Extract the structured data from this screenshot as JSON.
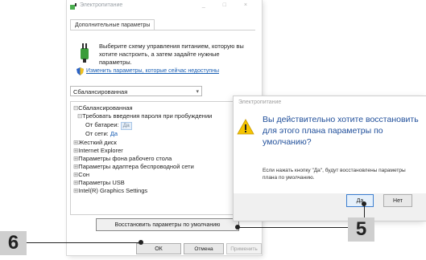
{
  "window": {
    "title": "Электропитание",
    "controls": "_ □ ×",
    "tab_label": "Дополнительные параметры",
    "intro_text": "Выберите схему управления питанием, которую вы хотите настроить, а затем задайте нужные параметры.",
    "change_link": "Изменить параметры, которые сейчас недоступны",
    "scheme_selected": "Сбалансированная"
  },
  "tree": {
    "root": "Сбалансированная",
    "require_password": "Требовать введения пароля при пробуждении",
    "on_battery_label": "От батареи:",
    "on_battery_value": "Да",
    "on_ac_label": "От сети:",
    "on_ac_value": "Да",
    "items": [
      "Жесткий диск",
      "Internet Explorer",
      "Параметры фона рабочего стола",
      "Параметры адаптера беспроводной сети",
      "Сон",
      "Параметры USB",
      "Intel(R) Graphics Settings"
    ]
  },
  "buttons": {
    "restore": "Восстановить параметры по умолчанию",
    "ok": "ОК",
    "cancel": "Отмена",
    "apply": "Применить"
  },
  "dialog": {
    "title": "Электропитание",
    "question": "Вы действительно хотите восстановить для этого плана параметры по умолчанию?",
    "note": "Если нажать кнопку \"Да\", будут восстановлены параметры плана по умолчанию.",
    "yes": "Да",
    "no": "Нет"
  },
  "callouts": {
    "step_6": "6",
    "step_5": "5"
  },
  "colors": {
    "accent_blue": "#1f4e9a",
    "link_blue": "#1a5fb4",
    "callout_bg": "#cfcfcf"
  }
}
